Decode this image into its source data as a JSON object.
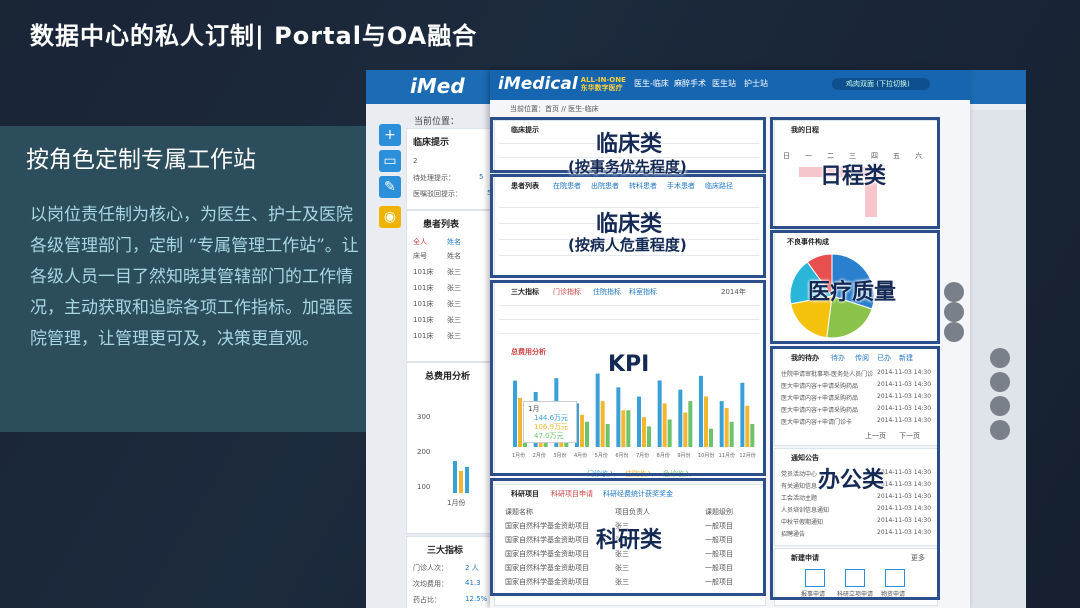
{
  "slide": {
    "title": "数据中心的私人订制| Portal与OA融合",
    "subheading": "按角色定制专属工作站",
    "body": "以岗位责任制为核心，为医生、护士及医院各级管理部门，定制 “专属管理工作站”。让各级人员一目了然知晓其管辖部门的工作情况，主动获取和追踪各项工作指标。加强医院管理，让管理更可及，决策更直观。"
  },
  "back_screen": {
    "logo": "iMed",
    "location": "当前位置：",
    "panel1_title": "临床提示",
    "panel2_title": "患者列表",
    "panel3_title": "总费用分析",
    "panel4_title": "三大指标",
    "row_labels": [
      "待处理提示：",
      "医嘱驳回提示："
    ],
    "row_values": [
      "2",
      "5",
      "5"
    ],
    "patient_tabs": [
      "全人",
      "姓名"
    ],
    "patient_header": [
      "床号",
      "姓名"
    ],
    "patient_rows": [
      [
        "101床",
        "张三"
      ],
      [
        "101床",
        "张三"
      ],
      [
        "101床",
        "张三"
      ],
      [
        "101床",
        "张三"
      ],
      [
        "101床",
        "张三"
      ]
    ],
    "chart_axis": [
      "300",
      "200",
      "100"
    ],
    "chart_month": "1月份",
    "kpi_rows": [
      [
        "门诊人次：",
        "2 人"
      ],
      [
        "次均费用：",
        "41.3"
      ],
      [
        "药占比：",
        "12.5%"
      ]
    ]
  },
  "front_screen": {
    "logo_main": "iMedical",
    "logo_sub1": "ALL-IN-ONE",
    "logo_sub2": "东华数字医疗",
    "nav": [
      "医生-临床",
      "麻醉手术",
      "医生站",
      "护士站"
    ],
    "user": "鸡肉双面 (下拉切换)",
    "location": "当前位置：首页 // 医生-临床",
    "panel_clinical_tip": "临床提示",
    "panel_patient_list": "患者列表",
    "patient_tabs": [
      "在院患者",
      "出院患者",
      "转科患者",
      "手术患者",
      "临床路径"
    ],
    "panel_kpi": "三大指标",
    "kpi_tabs": [
      "门诊指标",
      "住院指标",
      "科室指标"
    ],
    "kpi_date": "2014年",
    "chart_title": "总费用分析",
    "chart_legend": [
      "门诊收入",
      "住院收入",
      "急诊收入"
    ],
    "tooltip": [
      "1月",
      "144.6万元",
      "106.9万元",
      "47.0万元"
    ],
    "panel_research": "科研项目",
    "research_tabs": [
      "科研项目申请",
      "科研经费统计",
      "获奖奖金"
    ],
    "research_header": [
      "课题名称",
      "项目负责人",
      "课题级别"
    ],
    "research_rows": [
      [
        "国家自然科学基金资助项目",
        "张三",
        "一般项目"
      ],
      [
        "国家自然科学基金资助项目",
        "张三",
        "一般项目"
      ],
      [
        "国家自然科学基金资助项目",
        "张三",
        "一般项目"
      ],
      [
        "国家自然科学基金资助项目",
        "张三",
        "一般项目"
      ],
      [
        "国家自然科学基金资助项目",
        "张三",
        "一般项目"
      ]
    ],
    "panel_schedule": "我的日程",
    "schedule_days": [
      "日",
      "一",
      "二",
      "三",
      "四",
      "五",
      "六"
    ],
    "panel_adverse": "不良事件构成",
    "panel_todo": "我的待办",
    "todo_tabs": [
      "待办",
      "传阅",
      "已办",
      "新建"
    ],
    "todo_rows": [
      [
        "住院申请审批事项-医务处人员门诊",
        "2014-11-03 14:30"
      ],
      [
        "医大申请内容+申请采购药品",
        "2014-11-03 14:30"
      ],
      [
        "医大申请内容+申请采购药品",
        "2014-11-03 14:30"
      ],
      [
        "医大申请内容+申请采购药品",
        "2014-11-03 14:30"
      ],
      [
        "医大申请内容+申请门诊卡",
        "2014-11-03 14:30"
      ]
    ],
    "prev": "上一页",
    "next": "下一页",
    "panel_notice": "通知公告",
    "notice_rows": [
      [
        "党员活动中心",
        "2014-11-03 14:30"
      ],
      [
        "有关通知信息",
        "2014-11-03 14:30"
      ],
      [
        "工会活动主题",
        "2014-11-03 14:30"
      ],
      [
        "人员培训信息通知",
        "2014-11-03 14:30"
      ],
      [
        "中秋节假期通知",
        "2014-11-03 14:30"
      ],
      [
        "招聘通告",
        "2014-11-03 14:30"
      ]
    ],
    "panel_newrequest": "新建申请",
    "request_buttons": [
      "报事申请",
      "科研立项申请",
      "物资申请"
    ],
    "more": "更多"
  },
  "overlays": {
    "clinical1": "临床类",
    "clinical1_sub": "(按事务优先程度)",
    "clinical2": "临床类",
    "clinical2_sub": "(按病人危重程度)",
    "kpi": "KPI",
    "research": "科研类",
    "schedule": "日程类",
    "quality": "医疗质量",
    "office": "办公类"
  },
  "chart_data": {
    "type": "bar",
    "title": "总费用分析",
    "categories": [
      "1月份",
      "2月份",
      "3月份",
      "4月份",
      "5月份",
      "6月份",
      "7月份",
      "8月份",
      "9月份",
      "10月份",
      "11月份",
      "12月份"
    ],
    "series": [
      {
        "name": "门诊收入",
        "values": [
          144.6,
          120,
          150,
          95,
          160,
          130,
          110,
          145,
          125,
          155,
          100,
          140
        ],
        "color": "#3aa0d8"
      },
      {
        "name": "住院收入",
        "values": [
          106.9,
          60,
          90,
          70,
          100,
          80,
          65,
          95,
          75,
          110,
          85,
          90
        ],
        "color": "#f2b631"
      },
      {
        "name": "急诊收入",
        "values": [
          47.0,
          70,
          40,
          55,
          50,
          80,
          45,
          60,
          100,
          40,
          55,
          50
        ],
        "color": "#6cc36a"
      }
    ]
  },
  "pie_data": {
    "type": "pie",
    "title": "不良事件构成",
    "slices": [
      {
        "value": 30,
        "color": "#2a7fcf"
      },
      {
        "value": 22,
        "color": "#8bc34a"
      },
      {
        "value": 20,
        "color": "#f4c20d"
      },
      {
        "value": 18,
        "color": "#29b6d8"
      },
      {
        "value": 10,
        "color": "#e85050"
      }
    ]
  },
  "colors": {
    "accent": "#1565b0",
    "highlight": "#2c4f8c",
    "body_text": "#a8d6e5",
    "band": "#2d4f5d"
  }
}
